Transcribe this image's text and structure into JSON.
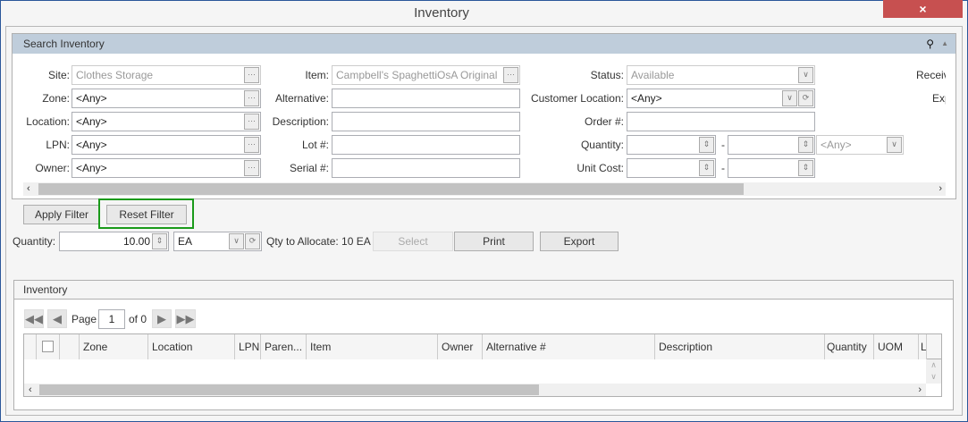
{
  "window": {
    "title": "Inventory",
    "close_icon": "×"
  },
  "search": {
    "title": "Search Inventory",
    "col1": [
      {
        "label": "Site:",
        "value": "Clothes Storage"
      },
      {
        "label": "Zone:",
        "value": "<Any>"
      },
      {
        "label": "Location:",
        "value": "<Any>"
      },
      {
        "label": "LPN:",
        "value": "<Any>"
      },
      {
        "label": "Owner:",
        "value": "<Any>"
      }
    ],
    "col2": [
      {
        "label": "Item:",
        "value": "Campbell's SpaghettiOsA Original"
      },
      {
        "label": "Alternative:",
        "value": ""
      },
      {
        "label": "Description:",
        "value": ""
      },
      {
        "label": "Lot #:",
        "value": ""
      },
      {
        "label": "Serial #:",
        "value": ""
      }
    ],
    "status": {
      "label": "Status:",
      "value": "Available"
    },
    "customer_location": {
      "label": "Customer Location:",
      "value": "<Any>"
    },
    "order": {
      "label": "Order #:",
      "value": ""
    },
    "quantity": {
      "label": "Quantity:",
      "from": "",
      "to": "",
      "unit": "<Any>",
      "dash": "-"
    },
    "unit_cost": {
      "label": "Unit Cost:",
      "from": "",
      "to": "",
      "dash": "-"
    },
    "col4": [
      "Receiv",
      "Exp"
    ]
  },
  "filter": {
    "apply": "Apply Filter",
    "reset": "Reset Filter"
  },
  "actions": {
    "quantity_label": "Quantity:",
    "quantity_value": "10.00",
    "uom": "EA",
    "qty_to_allocate": "Qty to Allocate: 10 EA",
    "select": "Select",
    "print": "Print",
    "export": "Export"
  },
  "grid": {
    "title": "Inventory",
    "page_label": "Page",
    "page": "1",
    "of": "of 0",
    "columns": [
      "Zone",
      "Location",
      "LPN",
      "Paren...",
      "Item",
      "Owner",
      "Alternative #",
      "Description",
      "Quantity",
      "UOM",
      "L"
    ]
  },
  "colors": {
    "accent": "#2b579a",
    "close": "#c75050",
    "highlight": "#1a9a1a",
    "header": "#bfcddb"
  }
}
